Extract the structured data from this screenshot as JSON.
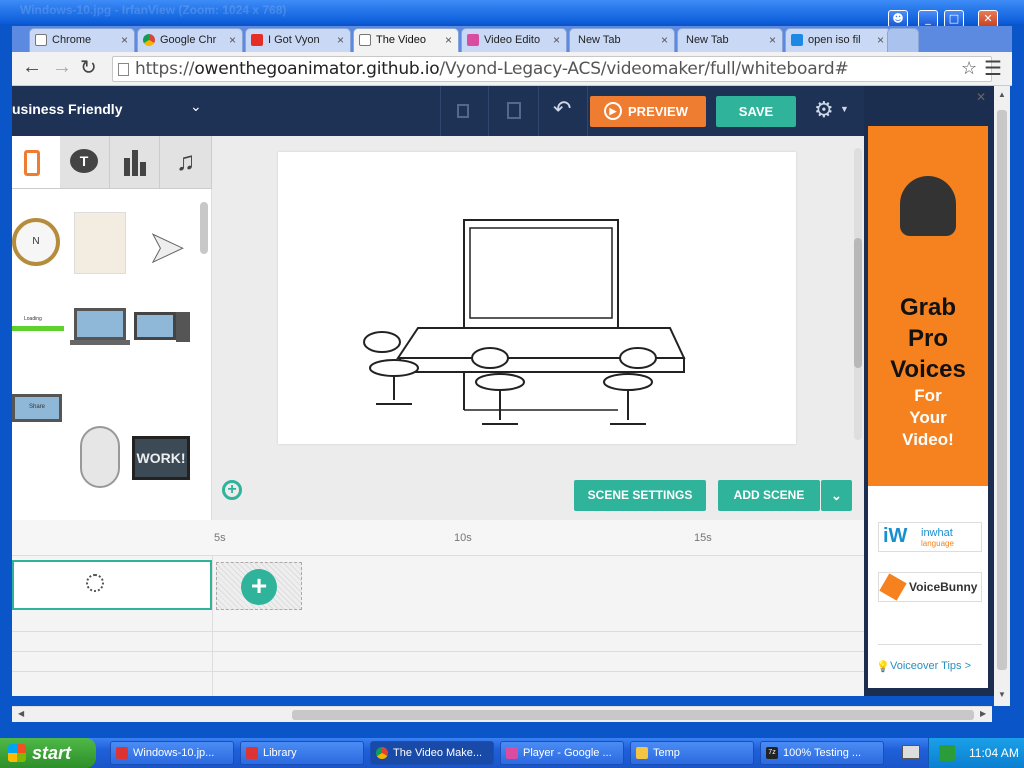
{
  "window": {
    "title": "Windows-10.jpg - IrfanView (Zoom: 1024 x 768)"
  },
  "tabs": [
    {
      "label": "Chrome"
    },
    {
      "label": "Google Chr"
    },
    {
      "label": "I Got Vyon"
    },
    {
      "label": "The Video"
    },
    {
      "label": "Video Edito"
    },
    {
      "label": "New Tab"
    },
    {
      "label": "New Tab"
    },
    {
      "label": "open iso fil"
    }
  ],
  "address": {
    "scheme": "https://",
    "host": "owenthegoanimator.github.io",
    "path": "/Vyond-Legacy-ACS/videomaker/full/whiteboard#"
  },
  "app": {
    "theme_label": "usiness Friendly",
    "preview_label": "PREVIEW",
    "save_label": "SAVE",
    "scene_settings_label": "SCENE SETTINGS",
    "add_scene_label": "ADD SCENE",
    "asset_text": {
      "loading": "Loading",
      "share": "Share",
      "work": "WORK!"
    },
    "ticks": [
      "5s",
      "10s",
      "15s"
    ]
  },
  "ad": {
    "headline_1": "Grab",
    "headline_2": "Pro",
    "headline_3": "Voices",
    "sub_1": "For",
    "sub_2": "Your",
    "sub_3": "Video!",
    "logo1_top": "inwhat",
    "logo1_bottom": "language",
    "logo2": "VoiceBunny",
    "tips": "Voiceover Tips >"
  },
  "taskbar": {
    "start": "start",
    "items": [
      {
        "label": "Windows-10.jp..."
      },
      {
        "label": "Library"
      },
      {
        "label": "The Video Make..."
      },
      {
        "label": "Player - Google ..."
      },
      {
        "label": "Temp"
      },
      {
        "label": "100% Testing ..."
      }
    ],
    "clock": "11:04 AM"
  },
  "colors": {
    "teal": "#2fb39a",
    "orange": "#ef7d31",
    "navy": "#1e3255",
    "ad_orange": "#f5821f"
  }
}
